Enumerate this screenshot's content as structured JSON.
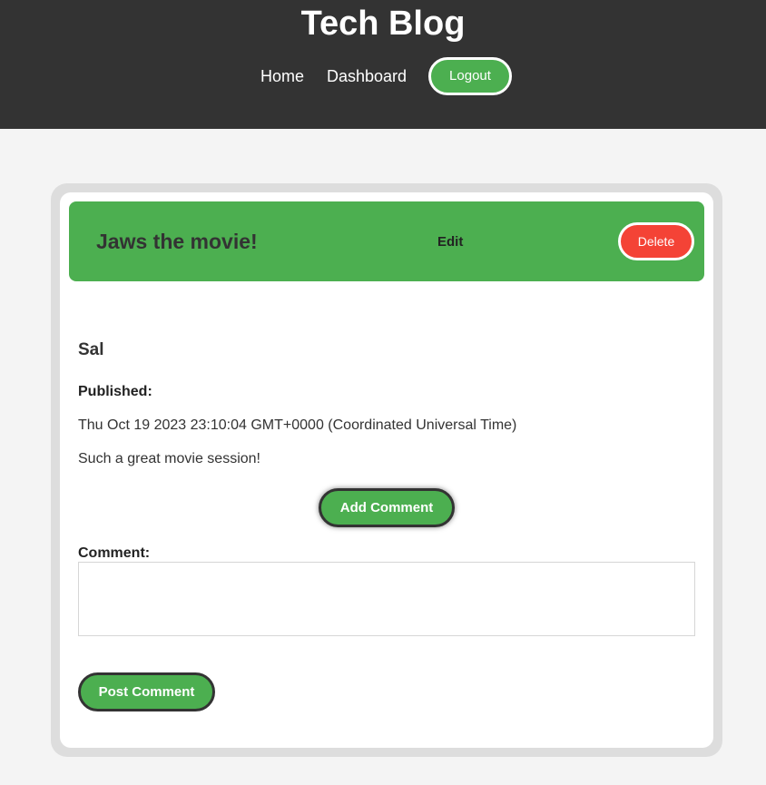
{
  "header": {
    "title": "Tech Blog",
    "nav": {
      "home": "Home",
      "dashboard": "Dashboard",
      "logout": "Logout"
    },
    "background_color": "#333333",
    "accent_color": "#4caf50"
  },
  "post": {
    "title": "Jaws the movie!",
    "edit_label": "Edit",
    "delete_label": "Delete",
    "author": "Sal",
    "published_label": "Published:",
    "published_date": "Thu Oct 19 2023 23:10:04 GMT+0000 (Coordinated Universal Time)",
    "content": "Such a great movie session!",
    "header_color": "#4caf50",
    "delete_color": "#f44336"
  },
  "comments": {
    "add_comment_label": "Add Comment",
    "comment_label": "Comment:",
    "comment_value": "",
    "post_comment_label": "Post Comment"
  }
}
